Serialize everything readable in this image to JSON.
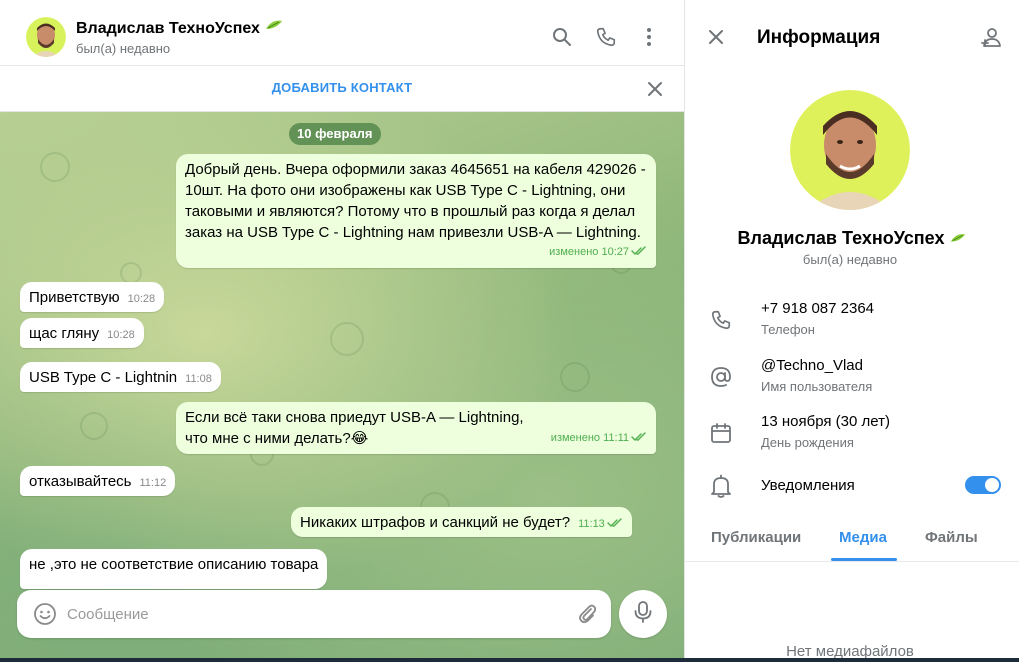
{
  "chat": {
    "contact_name": "Владислав ТехноУспех",
    "status": "был(а) недавно",
    "add_contact": "ДОБАВИТЬ КОНТАКТ",
    "date_separator": "10 февраля",
    "messages": [
      {
        "dir": "out",
        "text": "Добрый день. Вчера оформили заказ 4645651 на кабеля 429026 - 10шт. На фото они изображены как USB Type C - Lightning, они таковыми и являются? Потому что в прошлый раз когда я делал заказ на USB Type C - Lightning нам привезли USB-A — Lightning.",
        "meta": "изменено 10:27"
      },
      {
        "dir": "in",
        "text": "Приветствую",
        "meta": "10:28"
      },
      {
        "dir": "in",
        "text": "щас гляну",
        "meta": "10:28"
      },
      {
        "dir": "in",
        "text": "USB Type C - Lightnin",
        "meta": "11:08"
      },
      {
        "dir": "out",
        "text": "Если всё таки снова приедут USB-A — Lightning, что мне  с ними делать?😂",
        "meta": "изменено 11:11"
      },
      {
        "dir": "in",
        "text": "отказывайтесь",
        "meta": "11:12"
      },
      {
        "dir": "out",
        "text": "Никаких штрафов и санкций не будет?",
        "meta": "11:13"
      },
      {
        "dir": "in",
        "text": "не ,это не соответствие описанию товара",
        "meta": ""
      }
    ],
    "composer_placeholder": "Сообщение"
  },
  "info": {
    "title": "Информация",
    "name": "Владислав ТехноУспех",
    "status": "был(а) недавно",
    "phone": "+7 918 087 2364",
    "phone_label": "Телефон",
    "username": "@Techno_Vlad",
    "username_label": "Имя пользователя",
    "birthday": "13 ноября (30 лет)",
    "birthday_label": "День рождения",
    "notifications_label": "Уведомления",
    "notifications_on": true,
    "tabs": [
      "Публикации",
      "Медиа",
      "Файлы"
    ],
    "active_tab": "Медиа",
    "empty_media": "Нет медиафайлов"
  },
  "colors": {
    "accent": "#3390ec",
    "outgoing_bubble": "#eeffde",
    "incoming_bubble": "#ffffff",
    "read_ticks": "#4fae4e",
    "date_pill": "#56884c"
  },
  "icons": [
    "search-icon",
    "phone-icon",
    "more-vertical-icon",
    "close-icon",
    "add-contact-icon",
    "emoji-icon",
    "attach-icon",
    "mic-icon",
    "at-icon",
    "calendar-icon",
    "bell-icon",
    "leaf-badge-icon"
  ]
}
